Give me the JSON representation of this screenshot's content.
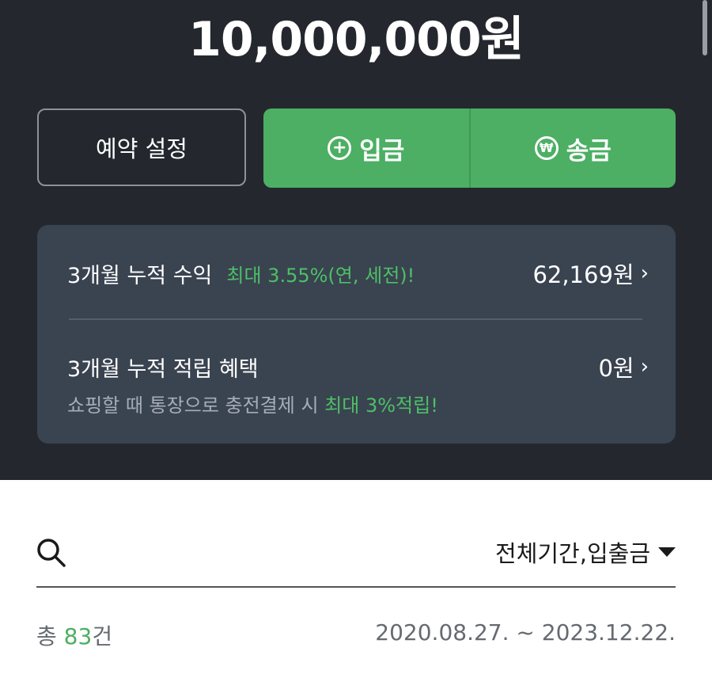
{
  "balance": "10,000,000원",
  "actions": {
    "schedule_label": "예약 설정",
    "deposit_label": "입금",
    "transfer_label": "송금"
  },
  "icons": {
    "plus": "+",
    "won": "₩",
    "chevron": "›"
  },
  "summary": {
    "interest_title": "3개월 누적 수익",
    "interest_rate_text": "최대 3.55%(연, 세전)!",
    "interest_value": "62,169원",
    "reward_title": "3개월 누적 적립 혜택",
    "reward_value": "0원",
    "reward_desc_prefix": "쇼핑할 때 통장으로 충전결제 시 ",
    "reward_desc_highlight": "최대 3%적립!"
  },
  "filter": {
    "label": "전체기간,입출금"
  },
  "transactions": {
    "count_prefix": "총 ",
    "count_value": "83",
    "count_suffix": "건",
    "date_range": "2020.08.27. ~ 2023.12.22."
  },
  "colors": {
    "accent_green": "#4caf63",
    "dark_bg": "#24282e",
    "card_bg": "#3a4350"
  }
}
